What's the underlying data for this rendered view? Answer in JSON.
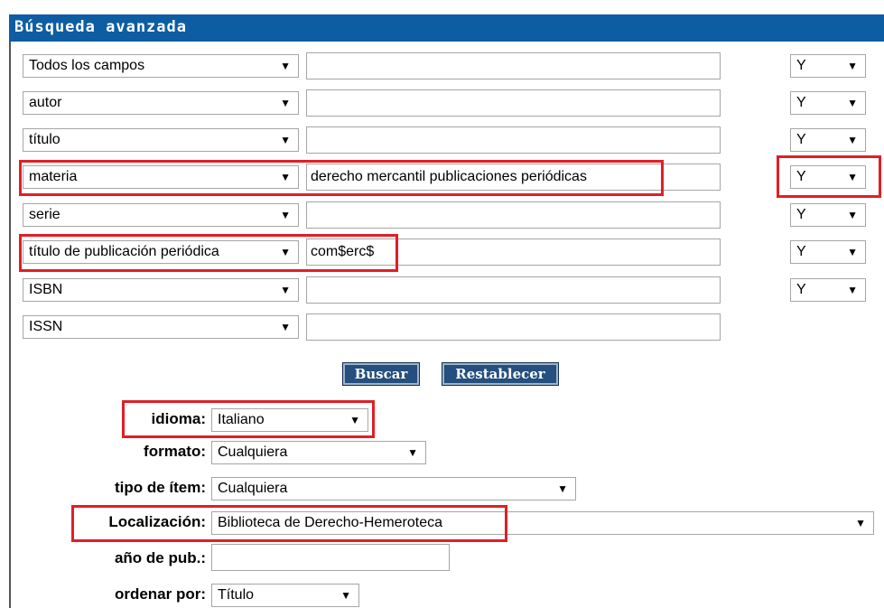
{
  "header": {
    "title": "Búsqueda avanzada"
  },
  "rows": [
    {
      "field": "Todos los campos",
      "term": "",
      "op": "Y"
    },
    {
      "field": "autor",
      "term": "",
      "op": "Y"
    },
    {
      "field": "título",
      "term": "",
      "op": "Y"
    },
    {
      "field": "materia",
      "term": "derecho mercantil publicaciones periódicas",
      "op": "Y"
    },
    {
      "field": "serie",
      "term": "",
      "op": "Y"
    },
    {
      "field": "título de publicación periódica",
      "term": "com$erc$",
      "op": "Y"
    },
    {
      "field": "ISBN",
      "term": "",
      "op": "Y"
    },
    {
      "field": "ISSN",
      "term": ""
    }
  ],
  "buttons": {
    "search": "Buscar",
    "reset": "Restablecer"
  },
  "filters": {
    "language": {
      "label": "idioma:",
      "value": "Italiano"
    },
    "format": {
      "label": "formato:",
      "value": "Cualquiera"
    },
    "item_type": {
      "label": "tipo de ítem:",
      "value": "Cualquiera"
    },
    "location": {
      "label": "Localización:",
      "value": "Biblioteca de Derecho-Hemeroteca"
    },
    "pub_year": {
      "label": "año de pub.:",
      "value": ""
    },
    "sort_by": {
      "label": "ordenar por:",
      "value": "Título"
    }
  },
  "icons": {
    "dropdown": "▼"
  },
  "colors": {
    "header": "#0d5da3",
    "button": "#244f7e",
    "highlight": "#e01f26"
  }
}
